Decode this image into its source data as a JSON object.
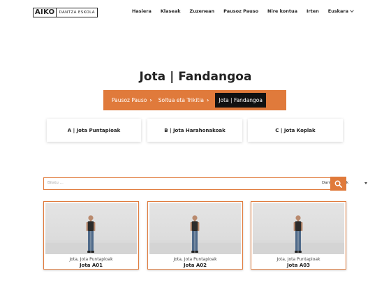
{
  "header": {
    "logo_mark": "AIKO",
    "logo_text": "DANTZA ESKOLA",
    "nav": [
      "Hasiera",
      "Klaseak",
      "Zuzenean",
      "Pausoz Pauso",
      "Nire kontua",
      "Irten"
    ],
    "language": "Euskara"
  },
  "page_title": "Jota | Fandangoa",
  "breadcrumb": {
    "items": [
      "Pausoz Pauso",
      "Soltua eta Trikitia",
      "Jota | Fandangoa"
    ],
    "separator": "›",
    "active_color": "#111111",
    "bg_color": "#e07a3b"
  },
  "categories": [
    "A | Jota Puntapioak",
    "B | Jota Harahonakoak",
    "C | Jota Koplak"
  ],
  "search": {
    "placeholder": "Bilatu ...",
    "select_value": "Dantza Motak",
    "accent_color": "#e07a3b"
  },
  "videos": [
    {
      "subtitle": "Jota, Jota Puntapioak",
      "title": "Jota A01"
    },
    {
      "subtitle": "Jota, Jota Puntapioak",
      "title": "Jota A02"
    },
    {
      "subtitle": "Jota, Jota Puntapioak",
      "title": "Jota A03"
    }
  ]
}
